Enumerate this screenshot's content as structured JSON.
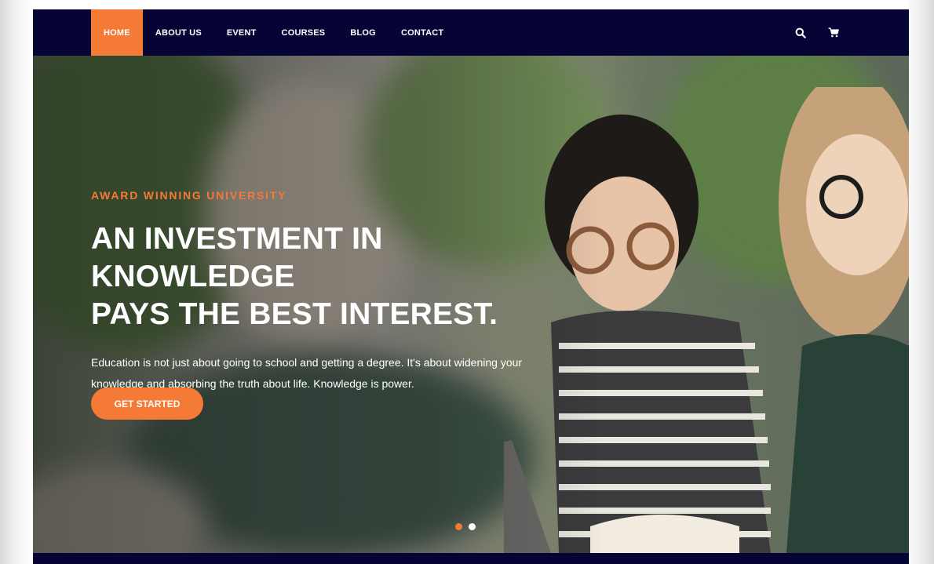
{
  "nav": {
    "items": [
      {
        "label": "HOME",
        "active": true
      },
      {
        "label": "ABOUT US",
        "active": false
      },
      {
        "label": "EVENT",
        "active": false
      },
      {
        "label": "COURSES",
        "active": false
      },
      {
        "label": "BLOG",
        "active": false
      },
      {
        "label": "CONTACT",
        "active": false
      }
    ],
    "icons": [
      "search-icon",
      "cart-icon"
    ]
  },
  "hero": {
    "kicker": "AWARD WINNING UNIVERSITY",
    "title_line1": "AN INVESTMENT IN KNOWLEDGE",
    "title_line2": "PAYS THE BEST INTEREST.",
    "text_line1": "Education is not just about going to school and getting a degree. It's about widening your",
    "text_line2": "knowledge and absorbing the truth about life. Knowledge is power.",
    "cta_label": "GET STARTED",
    "slides": 2,
    "active_slide": 1
  },
  "colors": {
    "navbar_bg": "#060335",
    "accent": "#f47a36",
    "text": "#ffffff"
  }
}
